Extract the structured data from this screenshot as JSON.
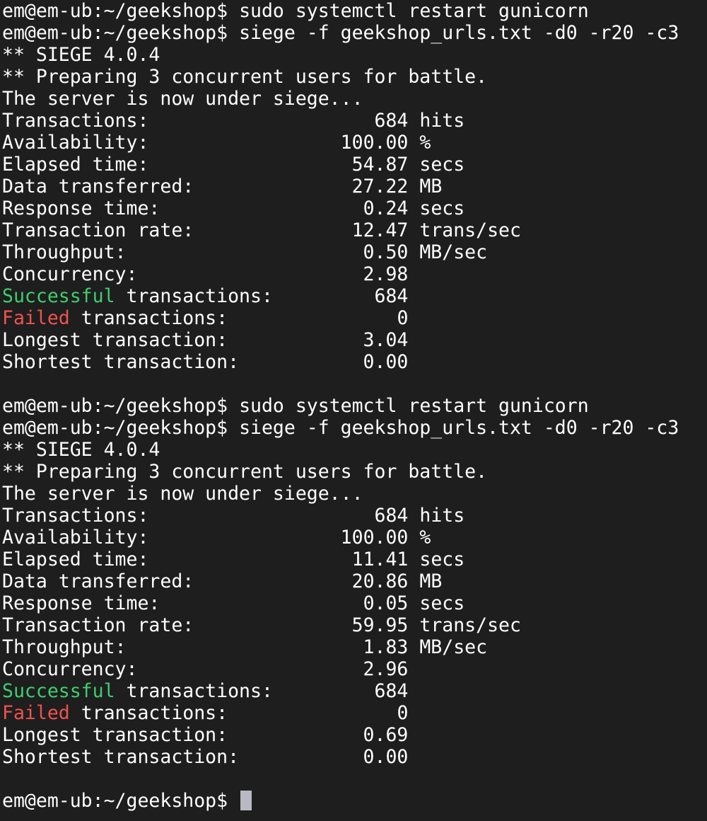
{
  "prompt": "em@em-ub:~/geekshop$",
  "runs": [
    {
      "cmd_restart": "sudo systemctl restart gunicorn",
      "cmd_siege": "siege -f geekshop_urls.txt -d0 -r20 -c3",
      "banner": "** SIEGE 4.0.4",
      "preparing": "** Preparing 3 concurrent users for battle.",
      "siege_msg": "The server is now under siege...",
      "stats": [
        {
          "label": "Transactions:",
          "value": "684",
          "unit": "hits"
        },
        {
          "label": "Availability:",
          "value": "100.00",
          "unit": "%"
        },
        {
          "label": "Elapsed time:",
          "value": "54.87",
          "unit": "secs"
        },
        {
          "label": "Data transferred:",
          "value": "27.22",
          "unit": "MB"
        },
        {
          "label": "Response time:",
          "value": "0.24",
          "unit": "secs"
        },
        {
          "label": "Transaction rate:",
          "value": "12.47",
          "unit": "trans/sec"
        },
        {
          "label": "Throughput:",
          "value": "0.50",
          "unit": "MB/sec"
        },
        {
          "label": "Concurrency:",
          "value": "2.98",
          "unit": ""
        },
        {
          "label_hl": "Successful",
          "label_rest": " transactions:",
          "hl": "green",
          "value": "684",
          "unit": ""
        },
        {
          "label_hl": "Failed",
          "label_rest": " transactions:",
          "hl": "red",
          "value": "0",
          "unit": ""
        },
        {
          "label": "Longest transaction:",
          "value": "3.04",
          "unit": ""
        },
        {
          "label": "Shortest transaction:",
          "value": "0.00",
          "unit": ""
        }
      ]
    },
    {
      "cmd_restart": "sudo systemctl restart gunicorn",
      "cmd_siege": "siege -f geekshop_urls.txt -d0 -r20 -c3",
      "banner": "** SIEGE 4.0.4",
      "preparing": "** Preparing 3 concurrent users for battle.",
      "siege_msg": "The server is now under siege...",
      "stats": [
        {
          "label": "Transactions:",
          "value": "684",
          "unit": "hits"
        },
        {
          "label": "Availability:",
          "value": "100.00",
          "unit": "%"
        },
        {
          "label": "Elapsed time:",
          "value": "11.41",
          "unit": "secs"
        },
        {
          "label": "Data transferred:",
          "value": "20.86",
          "unit": "MB"
        },
        {
          "label": "Response time:",
          "value": "0.05",
          "unit": "secs"
        },
        {
          "label": "Transaction rate:",
          "value": "59.95",
          "unit": "trans/sec"
        },
        {
          "label": "Throughput:",
          "value": "1.83",
          "unit": "MB/sec"
        },
        {
          "label": "Concurrency:",
          "value": "2.96",
          "unit": ""
        },
        {
          "label_hl": "Successful",
          "label_rest": " transactions:",
          "hl": "green",
          "value": "684",
          "unit": ""
        },
        {
          "label_hl": "Failed",
          "label_rest": " transactions:",
          "hl": "red",
          "value": "0",
          "unit": ""
        },
        {
          "label": "Longest transaction:",
          "value": "0.69",
          "unit": ""
        },
        {
          "label": "Shortest transaction:",
          "value": "0.00",
          "unit": ""
        }
      ]
    }
  ],
  "colors": {
    "background": "#1e1e1e",
    "text": "#ffffff",
    "success": "#3ecf6e",
    "failed": "#ef5350",
    "cursor": "#b9b9c3"
  }
}
